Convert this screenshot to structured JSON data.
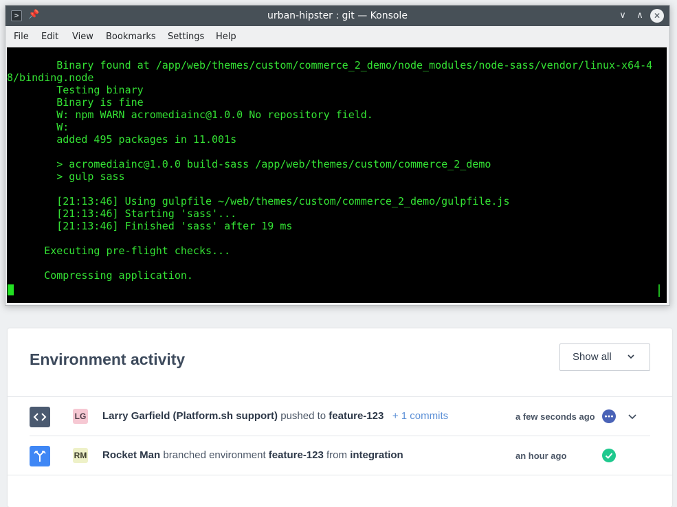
{
  "window": {
    "title": "urban-hipster : git — Konsole",
    "app_icon": "terminal-icon",
    "pin_icon": "pin-icon",
    "controls": [
      "minimize-icon",
      "maximize-icon",
      "close-icon"
    ]
  },
  "menu": [
    "File",
    "Edit",
    "View",
    "Bookmarks",
    "Settings",
    "Help"
  ],
  "terminal": {
    "lines": [
      "        Binary found at /app/web/themes/custom/commerce_2_demo/node_modules/node-sass/vendor/linux-x64-4",
      "8/binding.node",
      "        Testing binary",
      "        Binary is fine",
      "        W: npm WARN acromediainc@1.0.0 No repository field.",
      "        W:",
      "        added 495 packages in 11.001s",
      "",
      "        > acromediainc@1.0.0 build-sass /app/web/themes/custom/commerce_2_demo",
      "        > gulp sass",
      "",
      "        [21:13:46] Using gulpfile ~/web/themes/custom/commerce_2_demo/gulpfile.js",
      "        [21:13:46] Starting 'sass'...",
      "        [21:13:46] Finished 'sass' after 19 ms",
      "",
      "      Executing pre-flight checks...",
      "",
      "      Compressing application."
    ],
    "text_color": "#34e234",
    "background": "#000000"
  },
  "activity": {
    "heading": "Environment activity",
    "filter": {
      "selected": "Show all",
      "icon": "chevron-down-icon"
    },
    "rows": [
      {
        "type_icon": "code-icon",
        "type_color": "#4b5a70",
        "avatar": "LG",
        "avatar_bg": "#f6c8d3",
        "actor": "Larry Garfield (Platform.sh support)",
        "action": "pushed to",
        "target": "feature-123",
        "extra": "+ 1 commits",
        "time": "a few seconds ago",
        "status_icon": "in-progress-icon",
        "status_color": "#4a63b7"
      },
      {
        "type_icon": "branch-icon",
        "type_color": "#3f87f5",
        "avatar": "RM",
        "avatar_bg": "#eef1c8",
        "actor": "Rocket Man",
        "action": "branched environment",
        "target": "feature-123",
        "connector": "from",
        "source": "integration",
        "time": "an hour ago",
        "status_icon": "success-check-icon",
        "status_color": "#1fc98e"
      }
    ]
  }
}
